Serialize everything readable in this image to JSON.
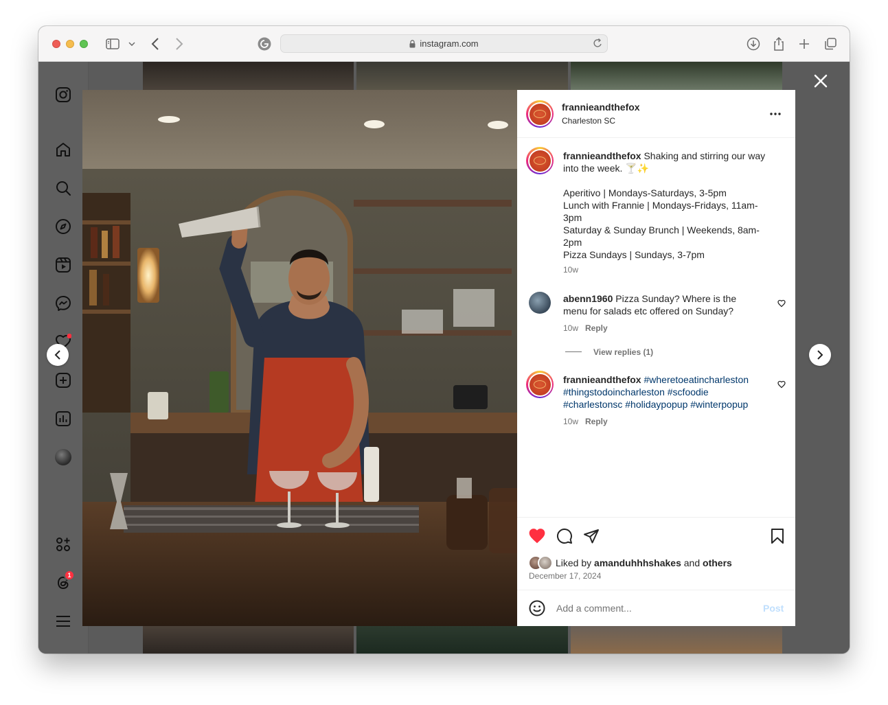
{
  "browser": {
    "url": "instagram.com",
    "colors": {
      "close": "#ee5e57",
      "minimize": "#f5bd4f",
      "zoom": "#60c454"
    }
  },
  "sidebar": {
    "items": [
      "instagram-icon",
      "home-icon",
      "search-icon",
      "explore-icon",
      "reels-icon",
      "messenger-icon",
      "heart-icon",
      "create-icon",
      "insights-icon",
      "profile-avatar",
      "threads-apps-icon",
      "threads-icon",
      "menu-icon"
    ],
    "threads_badge": "1"
  },
  "post": {
    "author": "frannieandthefox",
    "location": "Charleston SC",
    "caption": {
      "author": "frannieandthefox",
      "line1": "Shaking and stirring our way",
      "line2": "into the week. 🍸✨",
      "schedule": [
        "Aperitivo | Mondays-Saturdays, 3-5pm",
        "Lunch with Frannie | Mondays-Fridays, 11am-",
        "3pm",
        "Saturday & Sunday Brunch | Weekends, 8am-",
        "2pm",
        "Pizza Sundays | Sundays, 3-7pm"
      ],
      "time": "10w"
    },
    "comments": [
      {
        "author": "abenn1960",
        "line1": "Pizza Sunday? Where is the",
        "line2": "menu for salads etc offered on Sunday?",
        "time": "10w",
        "reply": "Reply",
        "view_replies": "View replies (1)"
      },
      {
        "author": "frannieandthefox",
        "line1_tag": "#whereto eatincharleston",
        "tags_line1": "#wheretoeatincharleston",
        "tags_line2": "#thingstodoincharleston #scfoodie",
        "tags_line3": "#charlestonsc #holidaypopup #winterpopup",
        "time": "10w",
        "reply": "Reply"
      }
    ],
    "liked_by_prefix": "Liked by",
    "liked_by_user": "amanduhhhshakes",
    "liked_by_and": "and",
    "liked_by_others": "others",
    "date": "December 17, 2024",
    "comment_placeholder": "Add a comment...",
    "post_button": "Post",
    "colors": {
      "like": "#ff3040",
      "link": "#00376b",
      "post_disabled": "#c0dffd"
    }
  }
}
